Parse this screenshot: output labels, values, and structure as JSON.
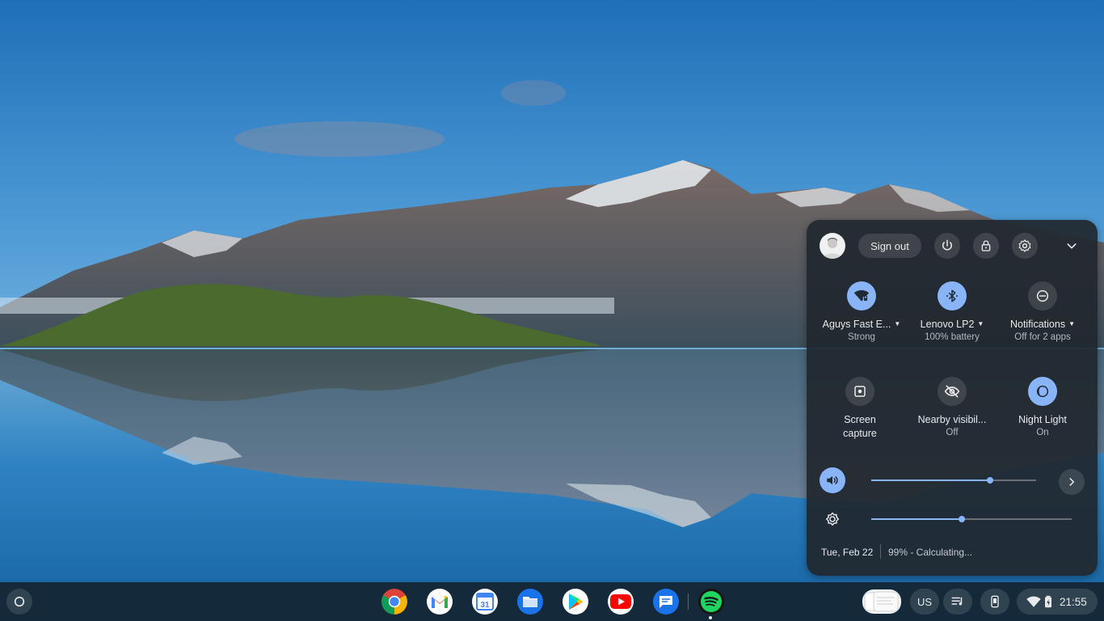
{
  "quick_settings": {
    "sign_out_label": "Sign out",
    "header_icons": [
      "power-icon",
      "lock-icon",
      "settings-icon",
      "chevron-down-icon"
    ],
    "tiles": [
      {
        "label": "Aguys Fast E...",
        "sublabel": "Strong",
        "icon": "wifi-locked-icon",
        "active": true,
        "has_menu": true
      },
      {
        "label": "Lenovo LP2",
        "sublabel": "100% battery",
        "icon": "bluetooth-connected-icon",
        "active": true,
        "has_menu": true
      },
      {
        "label": "Notifications",
        "sublabel": "Off for 2 apps",
        "icon": "do-not-disturb-icon",
        "active": false,
        "has_menu": true
      },
      {
        "label": "Screen\ncapture",
        "sublabel": "",
        "icon": "screen-capture-icon",
        "active": false,
        "has_menu": false
      },
      {
        "label": "Nearby visibil...",
        "sublabel": "Off",
        "icon": "nearby-visibility-off-icon",
        "active": false,
        "has_menu": false
      },
      {
        "label": "Night Light",
        "sublabel": "On",
        "icon": "night-light-icon",
        "active": true,
        "has_menu": false
      }
    ],
    "volume_level": 0.72,
    "brightness_level": 0.45,
    "date": "Tue, Feb 22",
    "battery_status": "99% - Calculating..."
  },
  "shelf": {
    "apps": [
      "chrome-icon",
      "gmail-icon",
      "calendar-icon",
      "files-icon",
      "play-store-icon",
      "youtube-icon",
      "messages-icon",
      "spotify-icon"
    ],
    "calendar_day": "31",
    "keyboard_layout": "US",
    "time": "21:55"
  },
  "colors": {
    "accent": "#8ab4f8",
    "panel_bg": "#20282e",
    "shelf_bg": "#12222e"
  }
}
